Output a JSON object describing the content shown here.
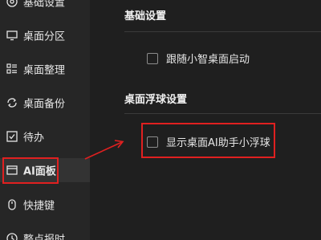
{
  "sidebar": {
    "items": [
      {
        "label": "基础设置",
        "icon": "settings-circle-icon"
      },
      {
        "label": "桌面分区",
        "icon": "monitor-icon"
      },
      {
        "label": "桌面整理",
        "icon": "grid-list-icon"
      },
      {
        "label": "桌面备份",
        "icon": "sync-icon"
      },
      {
        "label": "待办",
        "icon": "checkbox-icon"
      },
      {
        "label": "AI面板",
        "icon": "panel-icon"
      },
      {
        "label": "快捷键",
        "icon": "mouse-icon"
      },
      {
        "label": "整点报时",
        "icon": "clock-icon"
      }
    ],
    "active_index": 5
  },
  "main": {
    "section_basic": {
      "title": "基础设置",
      "option_autostart": "跟随小智桌面启动"
    },
    "section_float": {
      "title": "桌面浮球设置",
      "option_show_ai_ball": "显示桌面AI助手小浮球"
    }
  },
  "colors": {
    "background": "#1f1f1f",
    "sidebar": "#262626",
    "highlight": "#e02020",
    "text": "#e6e6e6"
  }
}
